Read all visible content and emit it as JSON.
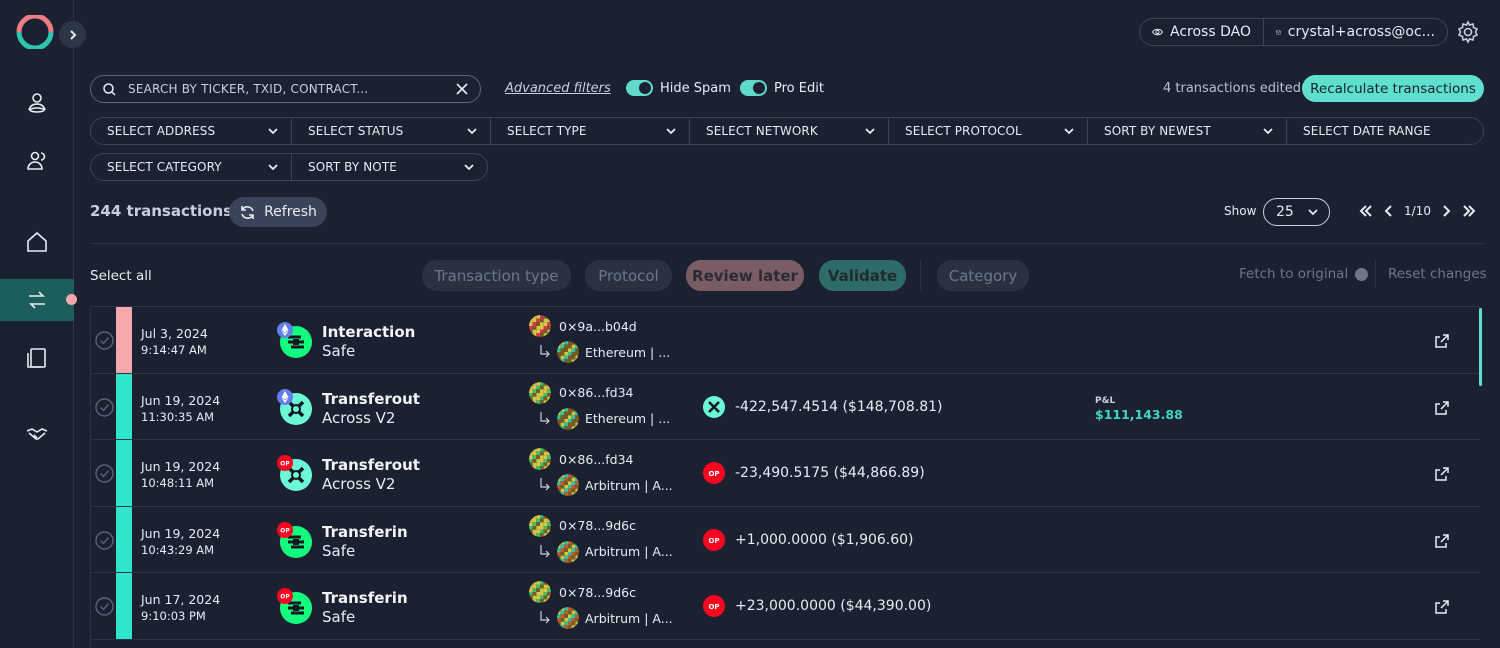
{
  "account": {
    "org": "Across DAO",
    "email": "crystal+across@oc..."
  },
  "search": {
    "placeholder": "SEARCH BY TICKER, TXID, CONTRACT..."
  },
  "advanced_filters_label": "Advanced filters",
  "toggles": {
    "hide_spam": "Hide Spam",
    "pro_edit": "Pro Edit"
  },
  "edited_text": "4 transactions edited",
  "recalc_label": "Recalculate transactions",
  "filters_row1": [
    "SELECT ADDRESS",
    "SELECT STATUS",
    "SELECT TYPE",
    "SELECT NETWORK",
    "SELECT PROTOCOL",
    "SORT BY NEWEST",
    "SELECT DATE RANGE"
  ],
  "filters_row2": [
    "SELECT CATEGORY",
    "SORT BY NOTE"
  ],
  "tx_count": "244 transactions",
  "refresh_label": "Refresh",
  "show_label": "Show",
  "page_size": "25",
  "page_indicator": "1/10",
  "select_all": "Select all",
  "bulk": {
    "transaction_type": "Transaction type",
    "protocol": "Protocol",
    "review_later": "Review later",
    "validate": "Validate",
    "category": "Category"
  },
  "fetch_original": "Fetch to original",
  "reset_changes": "Reset changes",
  "colors": {
    "accent": "#5fe0cf",
    "pnl": "#3fd6c2",
    "status_pink": "#f6a7ae",
    "status_teal": "#2ee6cc",
    "op_red": "#ff0420"
  },
  "rows": [
    {
      "date": "Jul 3, 2024",
      "time": "9:14:47 AM",
      "type": "Interaction",
      "protocol": "Safe",
      "network_icon": "ethereum-icon",
      "from": "0×9a...b04d",
      "to": "Ethereum | ...",
      "amount": "",
      "pnl_label": "",
      "pnl_value": "",
      "status": "pink"
    },
    {
      "date": "Jun 19, 2024",
      "time": "11:30:35 AM",
      "type": "Transferout",
      "protocol": "Across V2",
      "network_icon": "ethereum-icon",
      "from": "0×86...fd34",
      "to": "Ethereum | ...",
      "amount": "-422,547.4514 ($148,708.81)",
      "pnl_label": "P&L",
      "pnl_value": "$111,143.88",
      "status": "teal"
    },
    {
      "date": "Jun 19, 2024",
      "time": "10:48:11 AM",
      "type": "Transferout",
      "protocol": "Across V2",
      "network_icon": "optimism-icon",
      "from": "0×86...fd34",
      "to": "Arbitrum | A...",
      "amount": "-23,490.5175 ($44,866.89)",
      "pnl_label": "",
      "pnl_value": "",
      "status": "teal"
    },
    {
      "date": "Jun 19, 2024",
      "time": "10:43:29 AM",
      "type": "Transferin",
      "protocol": "Safe",
      "network_icon": "optimism-icon",
      "from": "0×78...9d6c",
      "to": "Arbitrum | A...",
      "amount": "+1,000.0000 ($1,906.60)",
      "pnl_label": "",
      "pnl_value": "",
      "status": "teal"
    },
    {
      "date": "Jun 17, 2024",
      "time": "9:10:03 PM",
      "type": "Transferin",
      "protocol": "Safe",
      "network_icon": "optimism-icon",
      "from": "0×78...9d6c",
      "to": "Arbitrum | A...",
      "amount": "+23,000.0000 ($44,390.00)",
      "pnl_label": "",
      "pnl_value": "",
      "status": "teal"
    }
  ]
}
